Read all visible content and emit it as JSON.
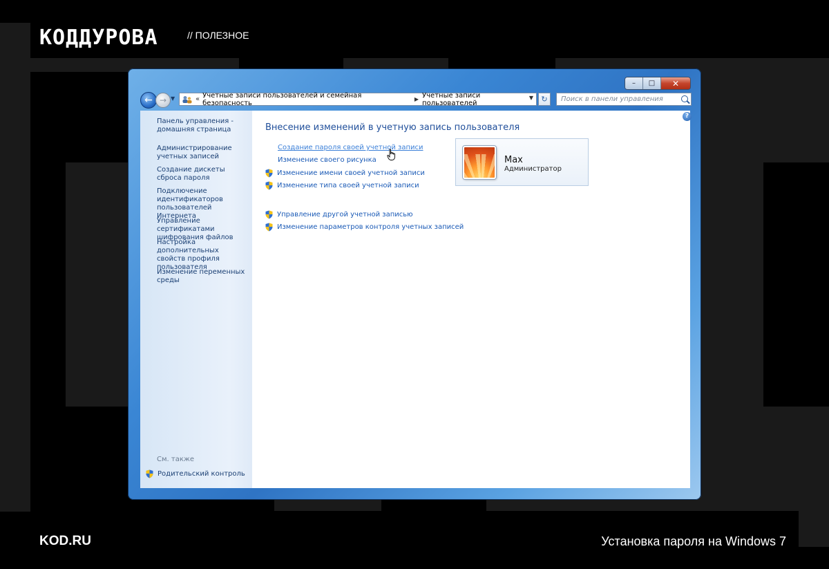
{
  "brand": {
    "logo": "КОДДУРОВА",
    "tag": "// ПОЛЕЗНОЕ"
  },
  "footer": {
    "site": "KOD.RU",
    "article_title": "Установка пароля на Windows 7"
  },
  "window": {
    "caption_buttons": [
      "minimize-icon",
      "maximize-icon",
      "close-icon"
    ],
    "address": {
      "chevron": "«",
      "crumbs": [
        "Учетные записи пользователей и семейная безопасность",
        "Учетные записи пользователей"
      ]
    },
    "search": {
      "placeholder": "Поиск в панели управления"
    }
  },
  "sidebar": {
    "items": [
      "Панель управления - домашняя страница",
      "Администрирование учетных записей",
      "Создание дискеты сброса пароля",
      "Подключение идентификаторов пользователей Интернета",
      "Управление сертификатами шифрования файлов",
      "Настройка дополнительных свойств профиля пользователя",
      "Изменение переменных среды"
    ],
    "see_also_label": "См. также",
    "parental_control": "Родительский контроль"
  },
  "main": {
    "title": "Внесение изменений в учетную запись пользователя",
    "tasks": [
      "Создание пароля своей учетной записи",
      "Изменение своего рисунка",
      "Изменение имени своей учетной записи",
      "Изменение типа своей учетной записи"
    ],
    "other_tasks": [
      "Управление другой учетной записью",
      "Изменение параметров контроля учетных записей"
    ]
  },
  "user": {
    "name": "Max",
    "role": "Администратор"
  },
  "colors": {
    "link": "#1a5ab6",
    "title": "#1f4e9a",
    "window_frame": "#2f74c4"
  }
}
